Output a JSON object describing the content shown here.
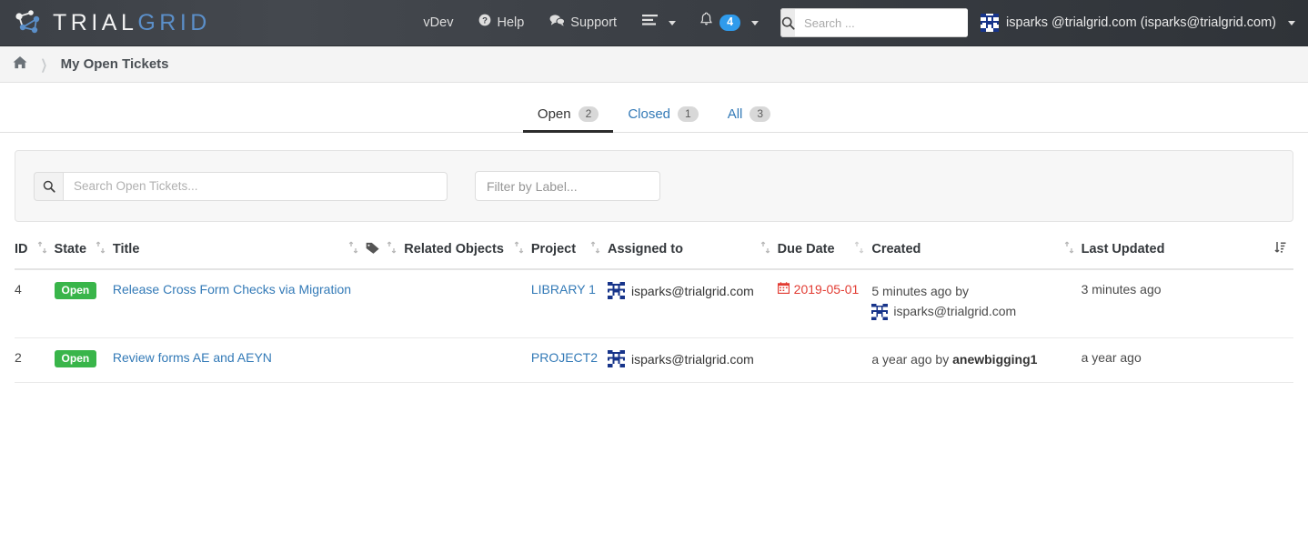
{
  "brand": {
    "part1": "TRIAL",
    "part2": "GRID",
    "logo_icon": "network-graph-logo-icon"
  },
  "navbar": {
    "links": [
      {
        "label": "vDev",
        "icon": null,
        "name": "nav-link-vdev"
      },
      {
        "label": "Help",
        "icon": "question-circle-icon",
        "name": "nav-link-help"
      },
      {
        "label": "Support",
        "icon": "comments-icon",
        "name": "nav-link-support"
      }
    ],
    "apps_menu": {
      "icon": "list-lines-icon",
      "label": ""
    },
    "notifications": {
      "icon": "bell-icon",
      "count": "4",
      "badge_color": "#2f9bec"
    },
    "search": {
      "placeholder": "Search ...",
      "value": "",
      "icon": "search-icon"
    },
    "user": {
      "label": "isparks @trialgrid.com (isparks@trialgrid.com)",
      "avatar_icon": "identicon-avatar"
    }
  },
  "breadcrumb": {
    "home_icon": "home-icon",
    "separator": "❯",
    "current": "My Open Tickets"
  },
  "tabs": [
    {
      "label": "Open",
      "count": "2",
      "active": true
    },
    {
      "label": "Closed",
      "count": "1",
      "active": false
    },
    {
      "label": "All",
      "count": "3",
      "active": false
    }
  ],
  "filters": {
    "search": {
      "placeholder": "Search Open Tickets...",
      "value": "",
      "icon": "search-icon"
    },
    "label": {
      "placeholder": "Filter by Label...",
      "value": ""
    }
  },
  "table": {
    "columns": [
      {
        "label": "ID",
        "sortable": true,
        "sort": "none"
      },
      {
        "label": "State",
        "sortable": true,
        "sort": "none"
      },
      {
        "label": "Title",
        "sortable": true,
        "sort": "none"
      },
      {
        "label": "",
        "icon": "tags-icon",
        "sortable": true,
        "sort": "none"
      },
      {
        "label": "Related Objects",
        "sortable": true,
        "sort": "none"
      },
      {
        "label": "Project",
        "sortable": true,
        "sort": "none"
      },
      {
        "label": "Assigned to",
        "sortable": true,
        "sort": "none"
      },
      {
        "label": "Due Date",
        "sortable": true,
        "sort": "none"
      },
      {
        "label": "Created",
        "sortable": true,
        "sort": "none"
      },
      {
        "label": "Last Updated",
        "sortable": true,
        "sort": "desc"
      }
    ],
    "rows": [
      {
        "id": "4",
        "state": "Open",
        "title": "Release Cross Form Checks via Migration",
        "tag": "",
        "related_objects": "",
        "project": "LIBRARY 1",
        "assigned_to": "isparks@trialgrid.com",
        "due_date": "2019-05-01",
        "due_overdue": true,
        "created_time": "5 minutes ago by",
        "created_by": "isparks@trialgrid.com",
        "created_by_has_avatar": true,
        "last_updated": "3 minutes ago"
      },
      {
        "id": "2",
        "state": "Open",
        "title": "Review forms AE and AEYN",
        "tag": "",
        "related_objects": "",
        "project": "PROJECT2",
        "assigned_to": "isparks@trialgrid.com",
        "due_date": "",
        "due_overdue": false,
        "created_time": "a year ago by",
        "created_by": "anewbigging1",
        "created_by_has_avatar": false,
        "last_updated": "a year ago"
      }
    ]
  },
  "colors": {
    "navbar_dark": "#3a3e44",
    "brand_blue": "#5b8fc9",
    "link_blue": "#337ab7",
    "badge_green": "#39b54a",
    "due_red": "#e23b32",
    "notify_blue": "#2f9bec"
  }
}
